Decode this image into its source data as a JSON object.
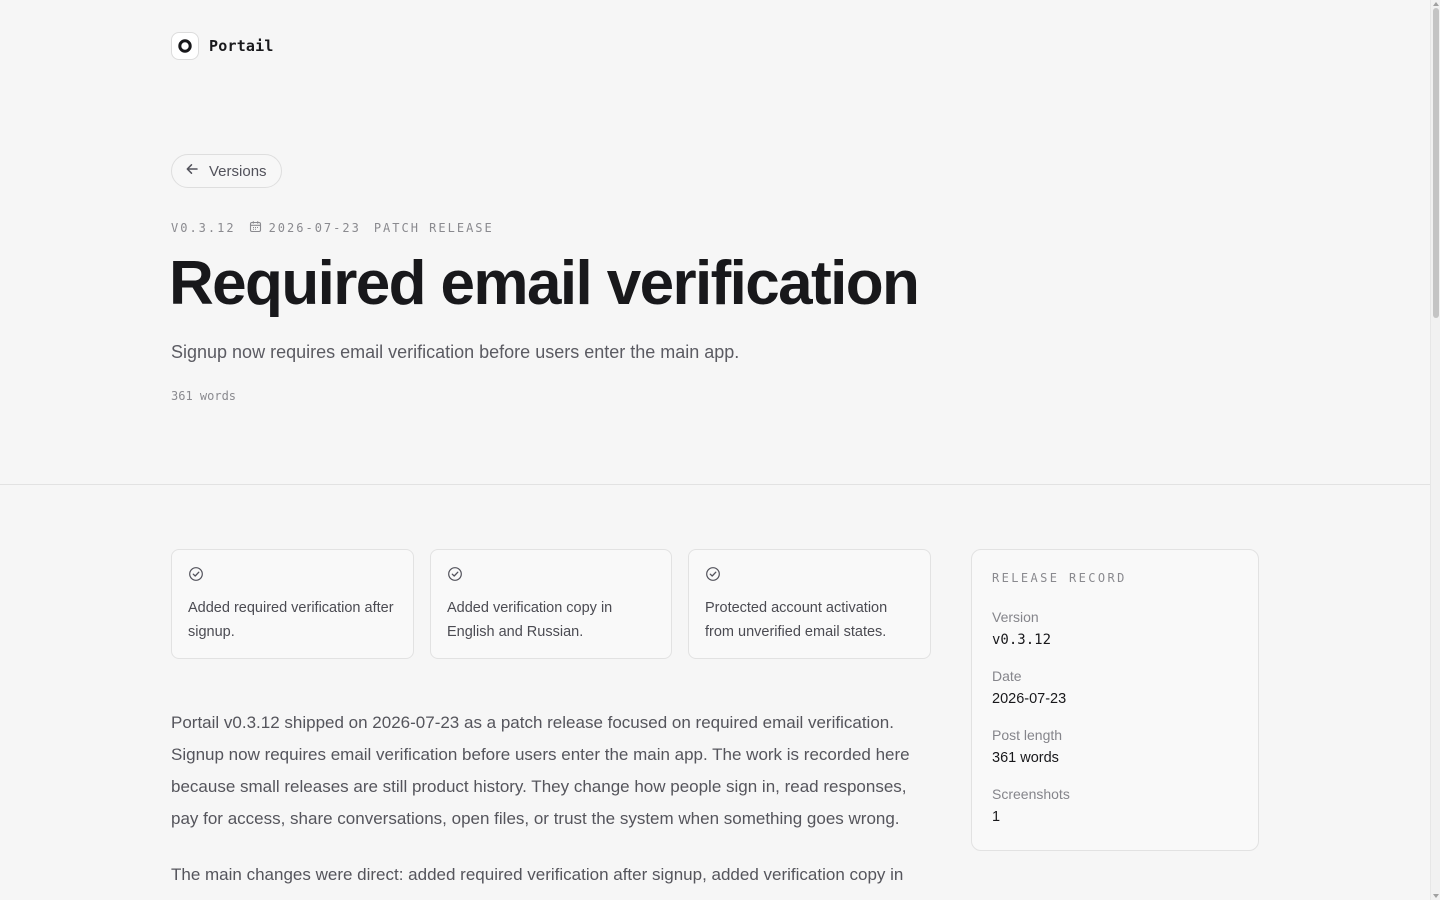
{
  "brand": {
    "name": "Portail",
    "logo_icon": "ring-logo-icon"
  },
  "back_link": {
    "label": "Versions",
    "icon": "arrow-left-icon"
  },
  "release": {
    "version_tag": "V0.3.12",
    "date": "2026-07-23",
    "date_icon": "calendar-icon",
    "type": "PATCH RELEASE",
    "title": "Required email verification",
    "subtitle": "Signup now requires email verification before users enter the main app.",
    "word_count": "361 words"
  },
  "changes": [
    {
      "icon": "check-circle-icon",
      "text": "Added required verification after signup."
    },
    {
      "icon": "check-circle-icon",
      "text": "Added verification copy in English and Russian."
    },
    {
      "icon": "check-circle-icon",
      "text": "Protected account activation from unverified email states."
    }
  ],
  "body": {
    "paragraph_1": "Portail v0.3.12 shipped on 2026-07-23 as a patch release focused on required email verification. Signup now requires email verification before users enter the main app. The work is recorded here because small releases are still product history. They change how people sign in, read responses, pay for access, share conversations, open files, or trust the system when something goes wrong.",
    "paragraph_2": "The main changes were direct: added required verification after signup, added verification copy in"
  },
  "record": {
    "title": "RELEASE RECORD",
    "rows": [
      {
        "label": "Version",
        "value": "v0.3.12"
      },
      {
        "label": "Date",
        "value": "2026-07-23"
      },
      {
        "label": "Post length",
        "value": "361 words"
      },
      {
        "label": "Screenshots",
        "value": "1"
      }
    ]
  },
  "colors": {
    "background": "#f6f6f6",
    "text": "#18181b",
    "muted": "#8a8a8f",
    "border": "#e2e2e2"
  }
}
